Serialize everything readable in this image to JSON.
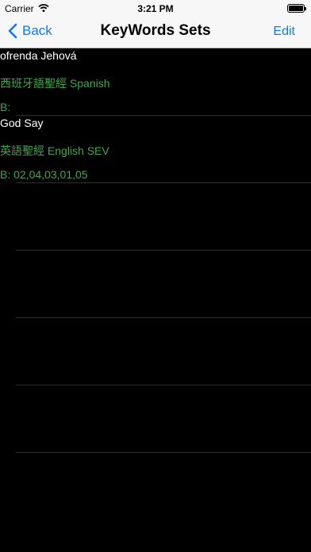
{
  "status_bar": {
    "carrier": "Carrier",
    "time": "3:21 PM",
    "wifi_icon": "wifi-icon",
    "battery_icon": "battery-icon"
  },
  "nav": {
    "back_label": "Back",
    "title": "KeyWords Sets",
    "edit_label": "Edit",
    "accent": "#0a7aff"
  },
  "rows": [
    {
      "keywords": "ofrenda  Jehová",
      "bible": "西班牙語聖經 Spanish",
      "book": "B:"
    },
    {
      "keywords": "God Say",
      "bible": "英語聖經 English SEV",
      "book": "B: 02,04,03,01,05"
    },
    {
      "keywords": "",
      "bible": "",
      "book": ""
    },
    {
      "keywords": "",
      "bible": "",
      "book": ""
    },
    {
      "keywords": "",
      "bible": "",
      "book": ""
    },
    {
      "keywords": "",
      "bible": "",
      "book": ""
    },
    {
      "keywords": "",
      "bible": "",
      "book": ""
    }
  ],
  "colors": {
    "background": "#000000",
    "keyword_text": "#ffffff",
    "detail_text": "#3ea84a"
  }
}
